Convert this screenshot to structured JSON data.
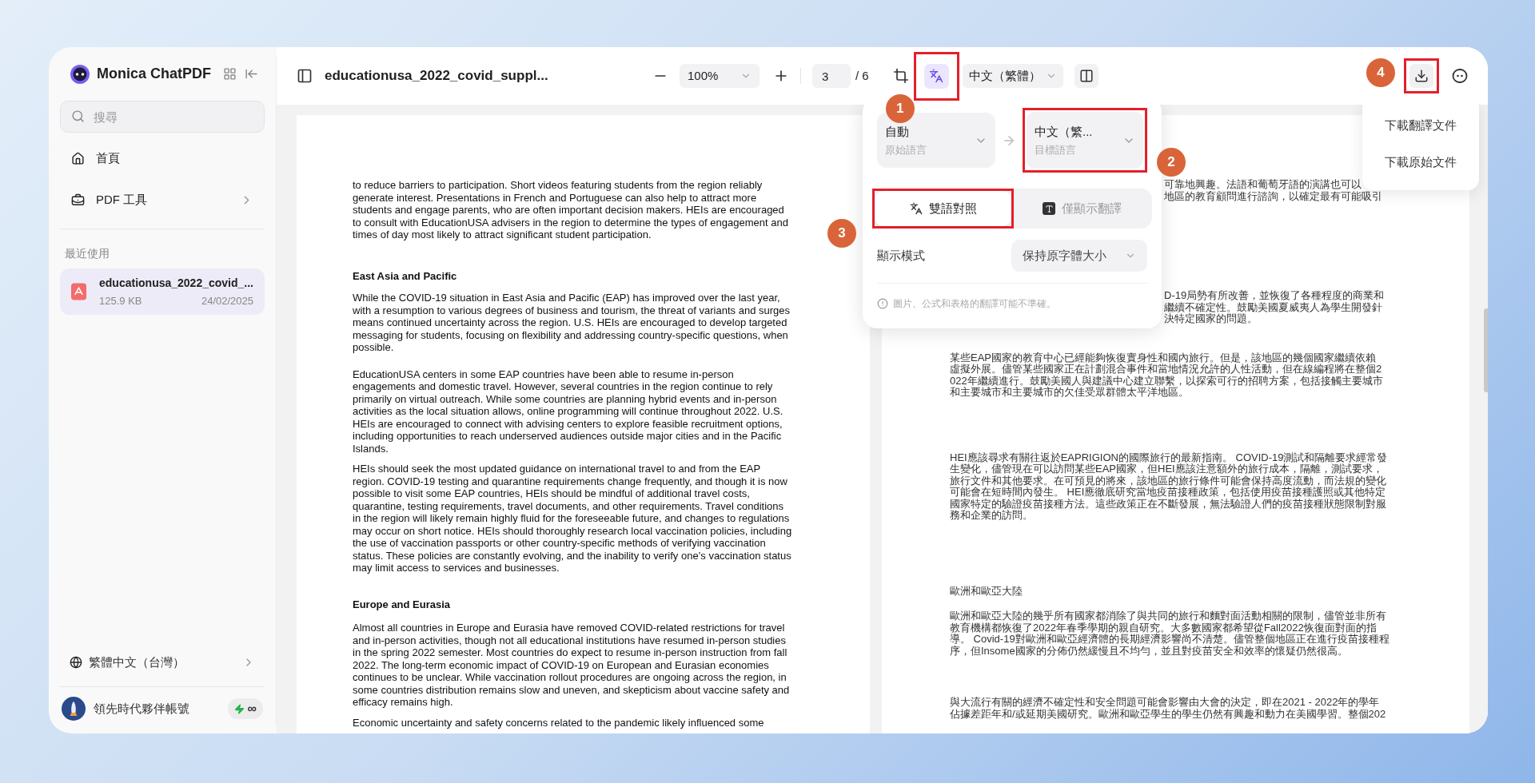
{
  "sidebar": {
    "brand": "Monica ChatPDF",
    "search": {
      "placeholder": "搜尋"
    },
    "nav": [
      {
        "label": "首頁",
        "has_submenu": false
      },
      {
        "label": "PDF 工具",
        "has_submenu": true
      }
    ],
    "recent_heading": "最近使用",
    "recent_files": [
      {
        "name": "educationusa_2022_covid_...",
        "size": "125.9 KB",
        "date": "24/02/2025",
        "selected": true
      }
    ],
    "language": "繁體中文（台灣）",
    "account": {
      "name": "領先時代夥伴帳號",
      "credits": "∞"
    }
  },
  "toolbar": {
    "file_title": "educationusa_2022_covid_suppl...",
    "zoom": "100%",
    "page": "3",
    "page_total": "/ 6",
    "translate_button": {
      "callout": "1"
    },
    "target_language": "中文（繁體）",
    "download_button": {
      "callout": "4"
    }
  },
  "translation_panel": {
    "source": {
      "value": "自動",
      "caption": "原始語言"
    },
    "target": {
      "value": "中文（繁...",
      "caption": "目標語言",
      "callout": "2"
    },
    "modes": [
      {
        "label": "雙語對照",
        "selected": true,
        "callout": "3"
      },
      {
        "label": "僅顯示翻譯",
        "selected": false
      }
    ],
    "display_mode": {
      "label": "顯示模式",
      "value": "保持原字體大小"
    },
    "note": "圖片、公式和表格的翻譯可能不準確。"
  },
  "download_menu": {
    "items": [
      "下載翻譯文件",
      "下載原始文件"
    ]
  },
  "original_page": {
    "blocks": [
      {
        "kind": "paragraph",
        "lines": [
          "to reduce barriers to participation. Short videos featuring students from the region reliably",
          "generate interest. Presentations in French and Portuguese can also help to attract more",
          "students and engage parents, who are often important decision makers. HEIs are encouraged",
          "to consult with EducationUSA advisers in the region to determine the types of engagement and",
          "times of day most likely to attract significant student participation."
        ]
      },
      {
        "kind": "heading",
        "lines": [
          "East Asia and Pacific"
        ]
      },
      {
        "kind": "paragraph",
        "lines": [
          "While the COVID-19 situation in East Asia and Pacific (EAP) has improved over the last year,",
          "with a resumption to various degrees of business and tourism, the threat of variants and surges",
          "means continued uncertainty across the region. U.S. HEIs are encouraged to develop targeted",
          "messaging for students, focusing on flexibility and addressing country-specific questions, when",
          "possible."
        ]
      },
      {
        "kind": "paragraph",
        "lines": [
          "EducationUSA centers in some EAP countries have been able to resume in-person",
          "engagements and domestic travel. However, several countries in the region continue to rely",
          "primarily on virtual outreach. While some countries are planning hybrid events and in-person",
          "activities as the local situation allows, online programming will continue throughout 2022. U.S.",
          "HEIs are encouraged to connect with advising centers to explore feasible recruitment options,",
          "including opportunities to reach underserved audiences outside major cities and in the Pacific",
          "Islands."
        ]
      },
      {
        "kind": "paragraph",
        "lines": [
          "HEIs should seek the most updated guidance on international travel to and from the EAP",
          "region. COVID-19 testing and quarantine requirements change frequently, and though it is now",
          "possible to visit some EAP countries, HEIs should be mindful of additional travel costs,",
          "quarantine, testing requirements, travel documents, and other requirements. Travel conditions",
          "in the region will likely remain highly fluid for the foreseeable future, and changes to regulations",
          "may occur on short notice. HEIs should thoroughly research local vaccination policies, including",
          "the use of vaccination passports or other country-specific methods of verifying vaccination",
          "status. These policies are constantly evolving, and the inability to verify one’s vaccination status",
          "may limit access to services and businesses."
        ]
      },
      {
        "kind": "heading",
        "lines": [
          "Europe and Eurasia"
        ]
      },
      {
        "kind": "paragraph",
        "lines": [
          "Almost all countries in Europe and Eurasia have removed COVID-related restrictions for travel",
          "and in-person activities, though not all educational institutions have resumed in-person studies",
          "in the spring 2022 semester. Most countries do expect to resume in-person instruction from fall",
          "2022. The long-term economic impact of COVID-19 on European and Eurasian economies",
          "continues to be unclear. While vaccination rollout procedures are ongoing across the region, in",
          "some countries distribution remains slow and uneven, and skepticism about vaccine safety and",
          "efficacy remains high."
        ]
      },
      {
        "kind": "paragraph",
        "lines": [
          "Economic uncertainty and safety concerns related to the pandemic likely influenced some"
        ]
      }
    ]
  },
  "translated_page": {
    "blocks": [
      {
        "kind": "partial",
        "lines": [
          "可靠地興趣。法語和葡萄牙語的演講也可以",
          "地區的教育顧問進行諮詢，以確定最有可能吸引"
        ]
      },
      {
        "kind": "partial",
        "lines": [
          "D-19局勢有所改善，並恢復了各種程度的商業和",
          "繼續不確定性。鼓勵美國夏威夷人為學生開發針",
          "決特定國家的問題。"
        ]
      },
      {
        "kind": "paragraph",
        "lines": [
          "某些EAP國家的教育中心已經能夠恢復實身性和國內旅行。但是，該地區的幾個國家繼續依賴",
          "虛擬外展。儘管某些國家正在計劃混合事件和當地情況允許的人性活動，但在線編程將在整個2",
          "022年繼續進行。鼓勵美國人與建議中心建立聯繫，以探索可行的招聘方案，包括接觸主要城市",
          "和主要城市和主要城市的欠佳受眾群體太平洋地區。"
        ]
      },
      {
        "kind": "paragraph",
        "lines": [
          "HEI應該尋求有關往返於EAPRIGION的國際旅行的最新指南。 COVID-19測試和隔離要求經常發",
          "生變化，儘管現在可以訪問某些EAP國家，但HEI應該注意額外的旅行成本，隔離，測試要求，",
          "旅行文件和其他要求。在可預見的將來，該地區的旅行條件可能會保持高度流動，而法規的變化",
          "可能會在短時間內發生。 HEI應徹底研究當地疫苗接種政策，包括使用疫苗接種護照或其他特定",
          "國家特定的驗證疫苗接種方法。這些政策正在不斷發展，無法驗證人們的疫苗接種狀態限制對服",
          "務和企業的訪問。"
        ]
      },
      {
        "kind": "heading",
        "lines": [
          "歐洲和歐亞大陸"
        ]
      },
      {
        "kind": "paragraph",
        "lines": [
          "歐洲和歐亞大陸的幾乎所有國家都消除了與共同的旅行和麵對面活動相關的限制，儘管並非所有",
          "教育機構都恢復了2022年春季學期的親自研究。大多數國家都希望從Fall2022恢復面對面的指",
          "導。 Covid-19對歐洲和歐亞經濟體的長期經濟影響尚不清楚。儘管整個地區正在進行疫苗接種程",
          "序，但Insome國家的分佈仍然緩慢且不均勻，並且對疫苗安全和效率的懷疑仍然很高。"
        ]
      },
      {
        "kind": "paragraph",
        "lines": [
          "與大流行有關的經濟不確定性和安全問題可能會影響由大會的決定，即在2021 - 2022年的學年",
          "佔據差距年和/或延期美國研究。歐洲和歐亞學生的學生仍然有興趣和動力在美國學習。整個202"
        ]
      }
    ]
  }
}
